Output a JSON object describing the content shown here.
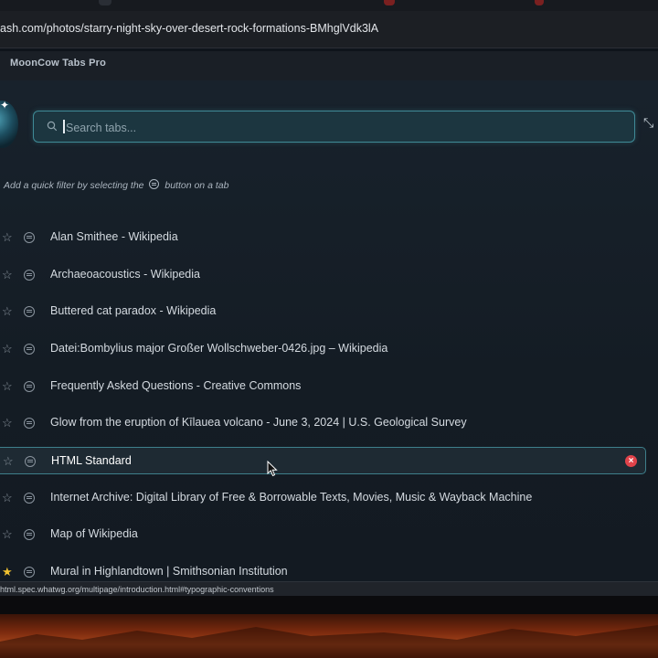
{
  "browser": {
    "url": "ash.com/photos/starry-night-sky-over-desert-rock-formations-BMhglVdk3lA",
    "status_url": "html.spec.whatwg.org/multipage/introduction.html#typographic-conventions"
  },
  "extension": {
    "title": "MoonCow Tabs Pro"
  },
  "search": {
    "placeholder": "Search tabs..."
  },
  "hint": {
    "before": "Add a quick filter by selecting the",
    "after": "button on a tab"
  },
  "tabs": [
    {
      "title": "Alan Smithee - Wikipedia",
      "starred": false
    },
    {
      "title": "Archaeoacoustics - Wikipedia",
      "starred": false
    },
    {
      "title": "Buttered cat paradox - Wikipedia",
      "starred": false
    },
    {
      "title": "Datei:Bombylius major Großer Wollschweber-0426.jpg – Wikipedia",
      "starred": false
    },
    {
      "title": "Frequently Asked Questions - Creative Commons",
      "starred": false
    },
    {
      "title": "Glow from the eruption of Kīlauea volcano - June 3, 2024 | U.S. Geological Survey",
      "starred": false
    },
    {
      "title": "HTML Standard",
      "starred": false,
      "selected": true
    },
    {
      "title": "Internet Archive: Digital Library of Free & Borrowable Texts, Movies, Music & Wayback Machine",
      "starred": false
    },
    {
      "title": "Map of Wikipedia",
      "starred": false
    },
    {
      "title": "Mural in Highlandtown | Smithsonian Institution",
      "starred": true
    }
  ],
  "icons": {
    "search": "search-icon",
    "filter": "filter-icon",
    "star": "star-icon",
    "close": "close-icon",
    "collapse": "collapse-icon"
  },
  "colors": {
    "accent": "#3f8a96",
    "close": "#e0434a",
    "star_filled": "#f2c230"
  }
}
